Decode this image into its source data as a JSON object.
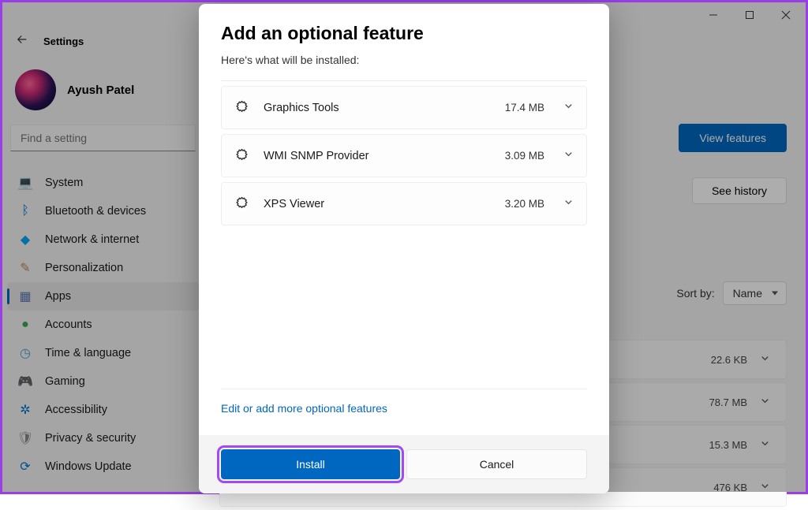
{
  "titlebar": {
    "min": "—",
    "max": "▢",
    "close": "✕"
  },
  "header": {
    "back_label": "Settings"
  },
  "profile": {
    "name": "Ayush Patel"
  },
  "search": {
    "placeholder": "Find a setting"
  },
  "nav": [
    {
      "id": "system",
      "label": "System",
      "icon": "💻",
      "color": "#0078d4"
    },
    {
      "id": "bluetooth",
      "label": "Bluetooth & devices",
      "icon": "ᛒ",
      "color": "#0078d4"
    },
    {
      "id": "network",
      "label": "Network & internet",
      "icon": "◆",
      "color": "#00a8f0"
    },
    {
      "id": "personalization",
      "label": "Personalization",
      "icon": "✎",
      "color": "#c0885a"
    },
    {
      "id": "apps",
      "label": "Apps",
      "icon": "▦",
      "color": "#5a7ab0",
      "active": true
    },
    {
      "id": "accounts",
      "label": "Accounts",
      "icon": "●",
      "color": "#3aa655"
    },
    {
      "id": "time",
      "label": "Time & language",
      "icon": "◷",
      "color": "#4aa0d8"
    },
    {
      "id": "gaming",
      "label": "Gaming",
      "icon": "🎮",
      "color": "#888"
    },
    {
      "id": "accessibility",
      "label": "Accessibility",
      "icon": "✲",
      "color": "#0078d4"
    },
    {
      "id": "privacy",
      "label": "Privacy & security",
      "icon": "🛡",
      "color": "#888"
    },
    {
      "id": "update",
      "label": "Windows Update",
      "icon": "⟳",
      "color": "#0078d4"
    }
  ],
  "main": {
    "view_features": "View features",
    "see_history": "See history",
    "sort_label": "Sort by:",
    "sort_value": "Name",
    "bg_items": [
      {
        "size": "22.6 KB"
      },
      {
        "size": "78.7 MB"
      },
      {
        "size": "15.3 MB"
      },
      {
        "size": "476 KB"
      }
    ]
  },
  "dialog": {
    "title": "Add an optional feature",
    "subtitle": "Here's what will be installed:",
    "features": [
      {
        "name": "Graphics Tools",
        "size": "17.4 MB"
      },
      {
        "name": "WMI SNMP Provider",
        "size": "3.09 MB"
      },
      {
        "name": "XPS Viewer",
        "size": "3.20 MB"
      }
    ],
    "edit_link": "Edit or add more optional features",
    "install": "Install",
    "cancel": "Cancel"
  }
}
